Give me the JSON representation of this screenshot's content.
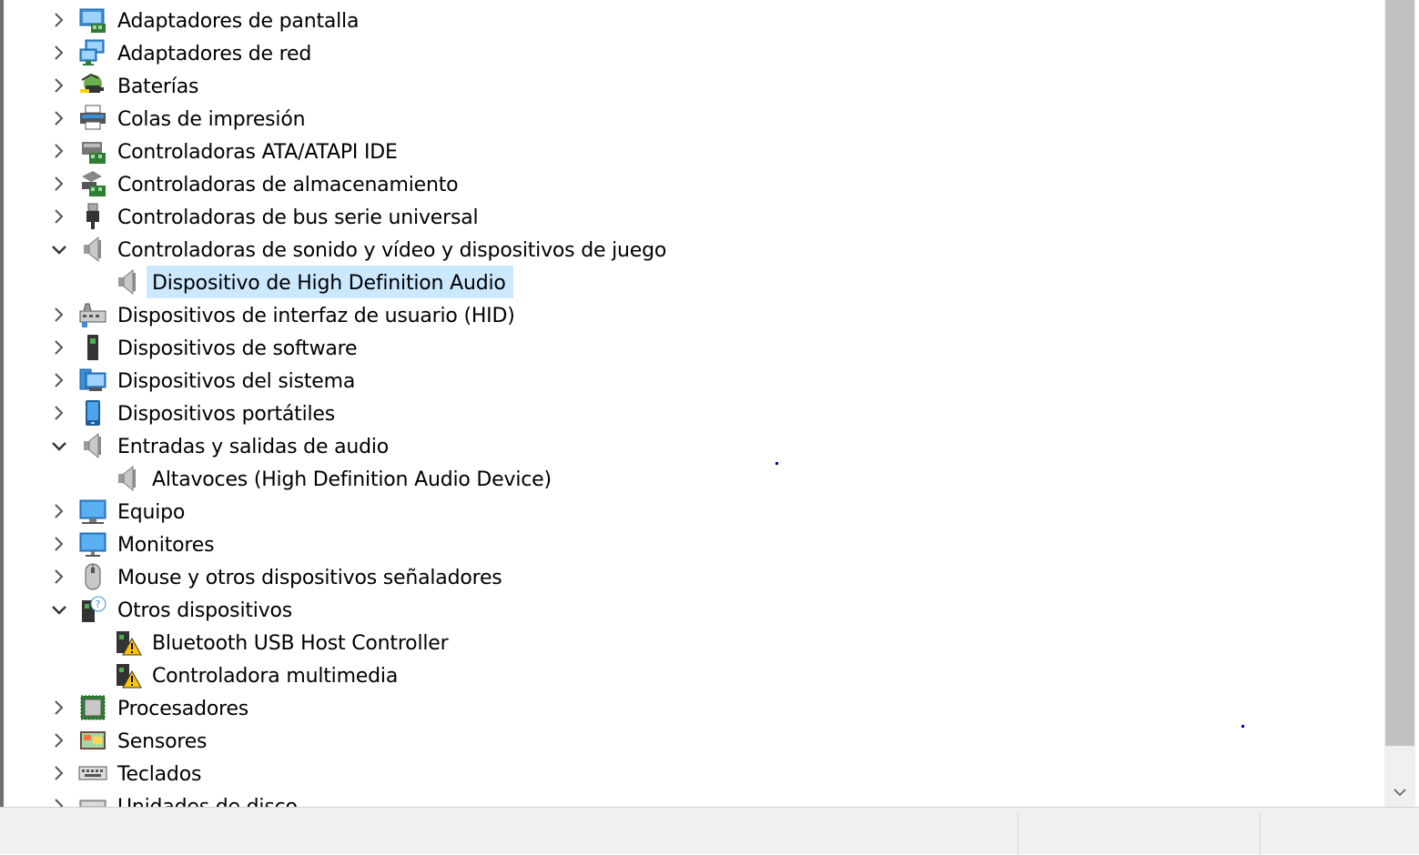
{
  "tree": {
    "items": [
      {
        "label": "Adaptadores de pantalla",
        "expanded": false,
        "icon": "display-adapter-icon"
      },
      {
        "label": "Adaptadores de red",
        "expanded": false,
        "icon": "network-adapter-icon"
      },
      {
        "label": "Baterías",
        "expanded": false,
        "icon": "battery-icon"
      },
      {
        "label": "Colas de impresión",
        "expanded": false,
        "icon": "printer-icon"
      },
      {
        "label": "Controladoras ATA/ATAPI IDE",
        "expanded": false,
        "icon": "ide-controller-icon"
      },
      {
        "label": "Controladoras de almacenamiento",
        "expanded": false,
        "icon": "storage-controller-icon"
      },
      {
        "label": "Controladoras de bus serie universal",
        "expanded": false,
        "icon": "usb-icon"
      },
      {
        "label": "Controladoras de sonido y vídeo y dispositivos de juego",
        "expanded": true,
        "icon": "speaker-icon"
      },
      {
        "label": "Dispositivo de High Definition Audio",
        "child": true,
        "selected": true,
        "icon": "speaker-icon"
      },
      {
        "label": "Dispositivos de interfaz de usuario (HID)",
        "expanded": false,
        "icon": "hid-icon"
      },
      {
        "label": "Dispositivos de software",
        "expanded": false,
        "icon": "software-device-icon"
      },
      {
        "label": "Dispositivos del sistema",
        "expanded": false,
        "icon": "system-devices-icon"
      },
      {
        "label": "Dispositivos portátiles",
        "expanded": false,
        "icon": "portable-device-icon"
      },
      {
        "label": "Entradas y salidas de audio",
        "expanded": true,
        "icon": "speaker-icon"
      },
      {
        "label": "Altavoces (High Definition Audio Device)",
        "child": true,
        "icon": "speaker-icon"
      },
      {
        "label": "Equipo",
        "expanded": false,
        "icon": "computer-icon"
      },
      {
        "label": "Monitores",
        "expanded": false,
        "icon": "monitor-icon"
      },
      {
        "label": "Mouse y otros dispositivos señaladores",
        "expanded": false,
        "icon": "mouse-icon"
      },
      {
        "label": "Otros dispositivos",
        "expanded": true,
        "icon": "unknown-device-icon"
      },
      {
        "label": "Bluetooth USB Host Controller",
        "child": true,
        "icon": "warning-device-icon"
      },
      {
        "label": "Controladora multimedia",
        "child": true,
        "icon": "warning-device-icon"
      },
      {
        "label": "Procesadores",
        "expanded": false,
        "icon": "processor-icon"
      },
      {
        "label": "Sensores",
        "expanded": false,
        "icon": "sensor-icon"
      },
      {
        "label": "Teclados",
        "expanded": false,
        "icon": "keyboard-icon"
      },
      {
        "label": "Unidades de disco",
        "expanded": false,
        "icon": "disk-drive-icon"
      }
    ]
  },
  "scrollbar": {
    "down_arrow_icon": "chevron-down-icon"
  },
  "colors": {
    "selection": "#cce8ff",
    "scroll_thumb": "#c1c1c1",
    "status_bg": "#f0f0f0"
  }
}
